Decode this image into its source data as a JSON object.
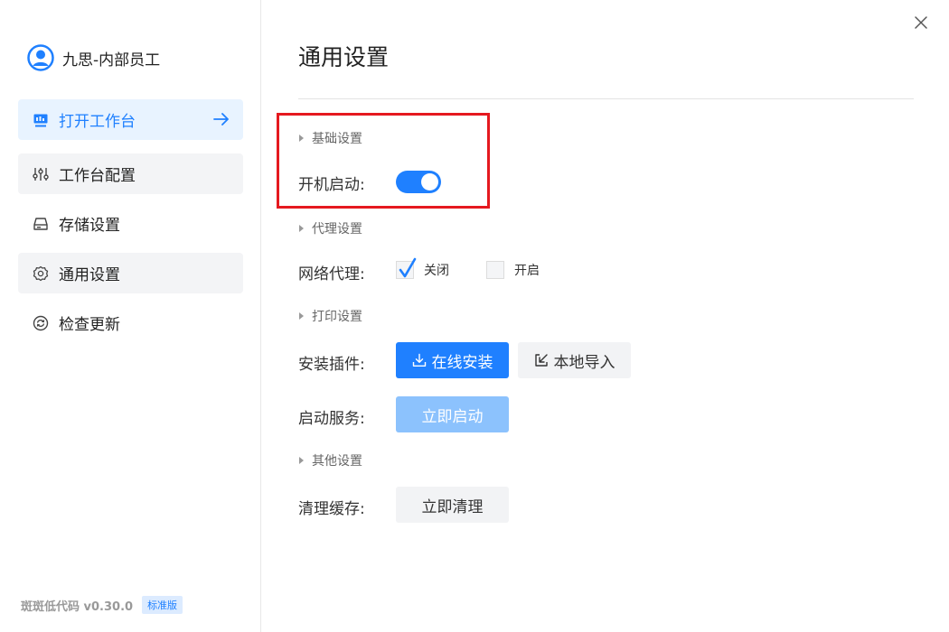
{
  "user": {
    "name": "九思-内部员工",
    "avatar_icon": "user-avatar-icon"
  },
  "sidebar": {
    "items": [
      {
        "label": "打开工作台",
        "icon": "monitor-icon",
        "state": "active"
      },
      {
        "label": "工作台配置",
        "icon": "sliders-icon",
        "state": "hover"
      },
      {
        "label": "存储设置",
        "icon": "drive-icon",
        "state": "normal"
      },
      {
        "label": "通用设置",
        "icon": "gear-icon",
        "state": "selected"
      },
      {
        "label": "检查更新",
        "icon": "refresh-icon",
        "state": "normal"
      }
    ]
  },
  "footer": {
    "version": "斑斑低代码 v0.30.0",
    "badge": "标准版"
  },
  "main": {
    "title": "通用设置",
    "sections": {
      "basic": {
        "header": "基础设置",
        "boot_label": "开机启动:",
        "boot_enabled": true
      },
      "proxy": {
        "header": "代理设置",
        "label": "网络代理:",
        "options": [
          {
            "label": "关闭",
            "checked": true
          },
          {
            "label": "开启",
            "checked": false
          }
        ]
      },
      "print": {
        "header": "打印设置",
        "install_label": "安装插件:",
        "online_install": "在线安装",
        "local_import": "本地导入",
        "service_label": "启动服务:",
        "start_now": "立即启动"
      },
      "other": {
        "header": "其他设置",
        "cache_label": "清理缓存:",
        "clean_now": "立即清理"
      }
    }
  },
  "colors": {
    "accent": "#1f80ff",
    "active_bg": "#e8f3ff",
    "highlight": "#e5191f",
    "disabled_btn": "#8cc2fd"
  }
}
